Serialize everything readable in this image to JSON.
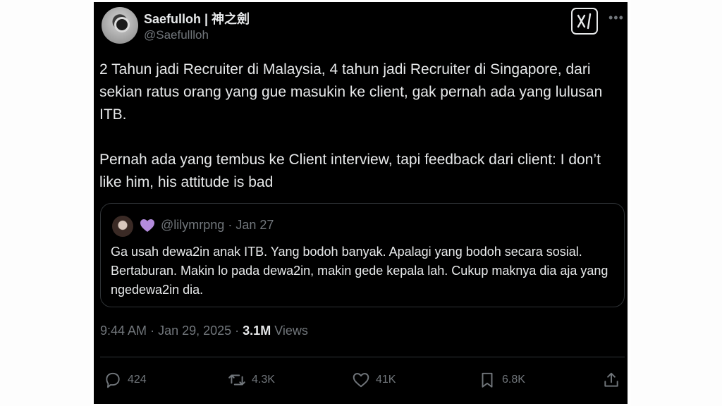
{
  "author": {
    "name": "Saefulloh | 神之劍",
    "handle": "@Saefullloh"
  },
  "tweet": {
    "paragraph1": "2 Tahun jadi Recruiter di Malaysia, 4 tahun jadi Recruiter di Singapore, dari sekian ratus orang yang gue masukin ke client, gak pernah ada yang lulusan ITB.",
    "paragraph2": "Pernah ada yang tembus ke Client interview, tapi feedback dari client: I don’t like him, his attitude is bad"
  },
  "quote": {
    "handle": "@lilymrpng",
    "date": "Jan 27",
    "text": "Ga usah dewa2in anak ITB. Yang bodoh banyak. Apalagi yang bodoh secara sosial. Bertaburan. Makin lo pada dewa2in, makin gede kepala lah. Cukup maknya dia aja yang ngedewa2in dia.",
    "badge_color": "#b38bdc"
  },
  "meta": {
    "time": "9:44 AM",
    "date": "Jan 29, 2025",
    "views_count": "3.1M",
    "views_label": "Views"
  },
  "actions": {
    "replies": "424",
    "reposts": "4.3K",
    "likes": "41K",
    "bookmarks": "6.8K"
  },
  "icons": {
    "grok": "grok-icon",
    "more": "more-icon",
    "reply": "reply-icon",
    "repost": "repost-icon",
    "like": "heart-icon",
    "bookmark": "bookmark-icon",
    "share": "share-icon"
  },
  "colors": {
    "background": "#000000",
    "text": "#e7e9ea",
    "secondary": "#71767b",
    "border": "#2f3336"
  }
}
